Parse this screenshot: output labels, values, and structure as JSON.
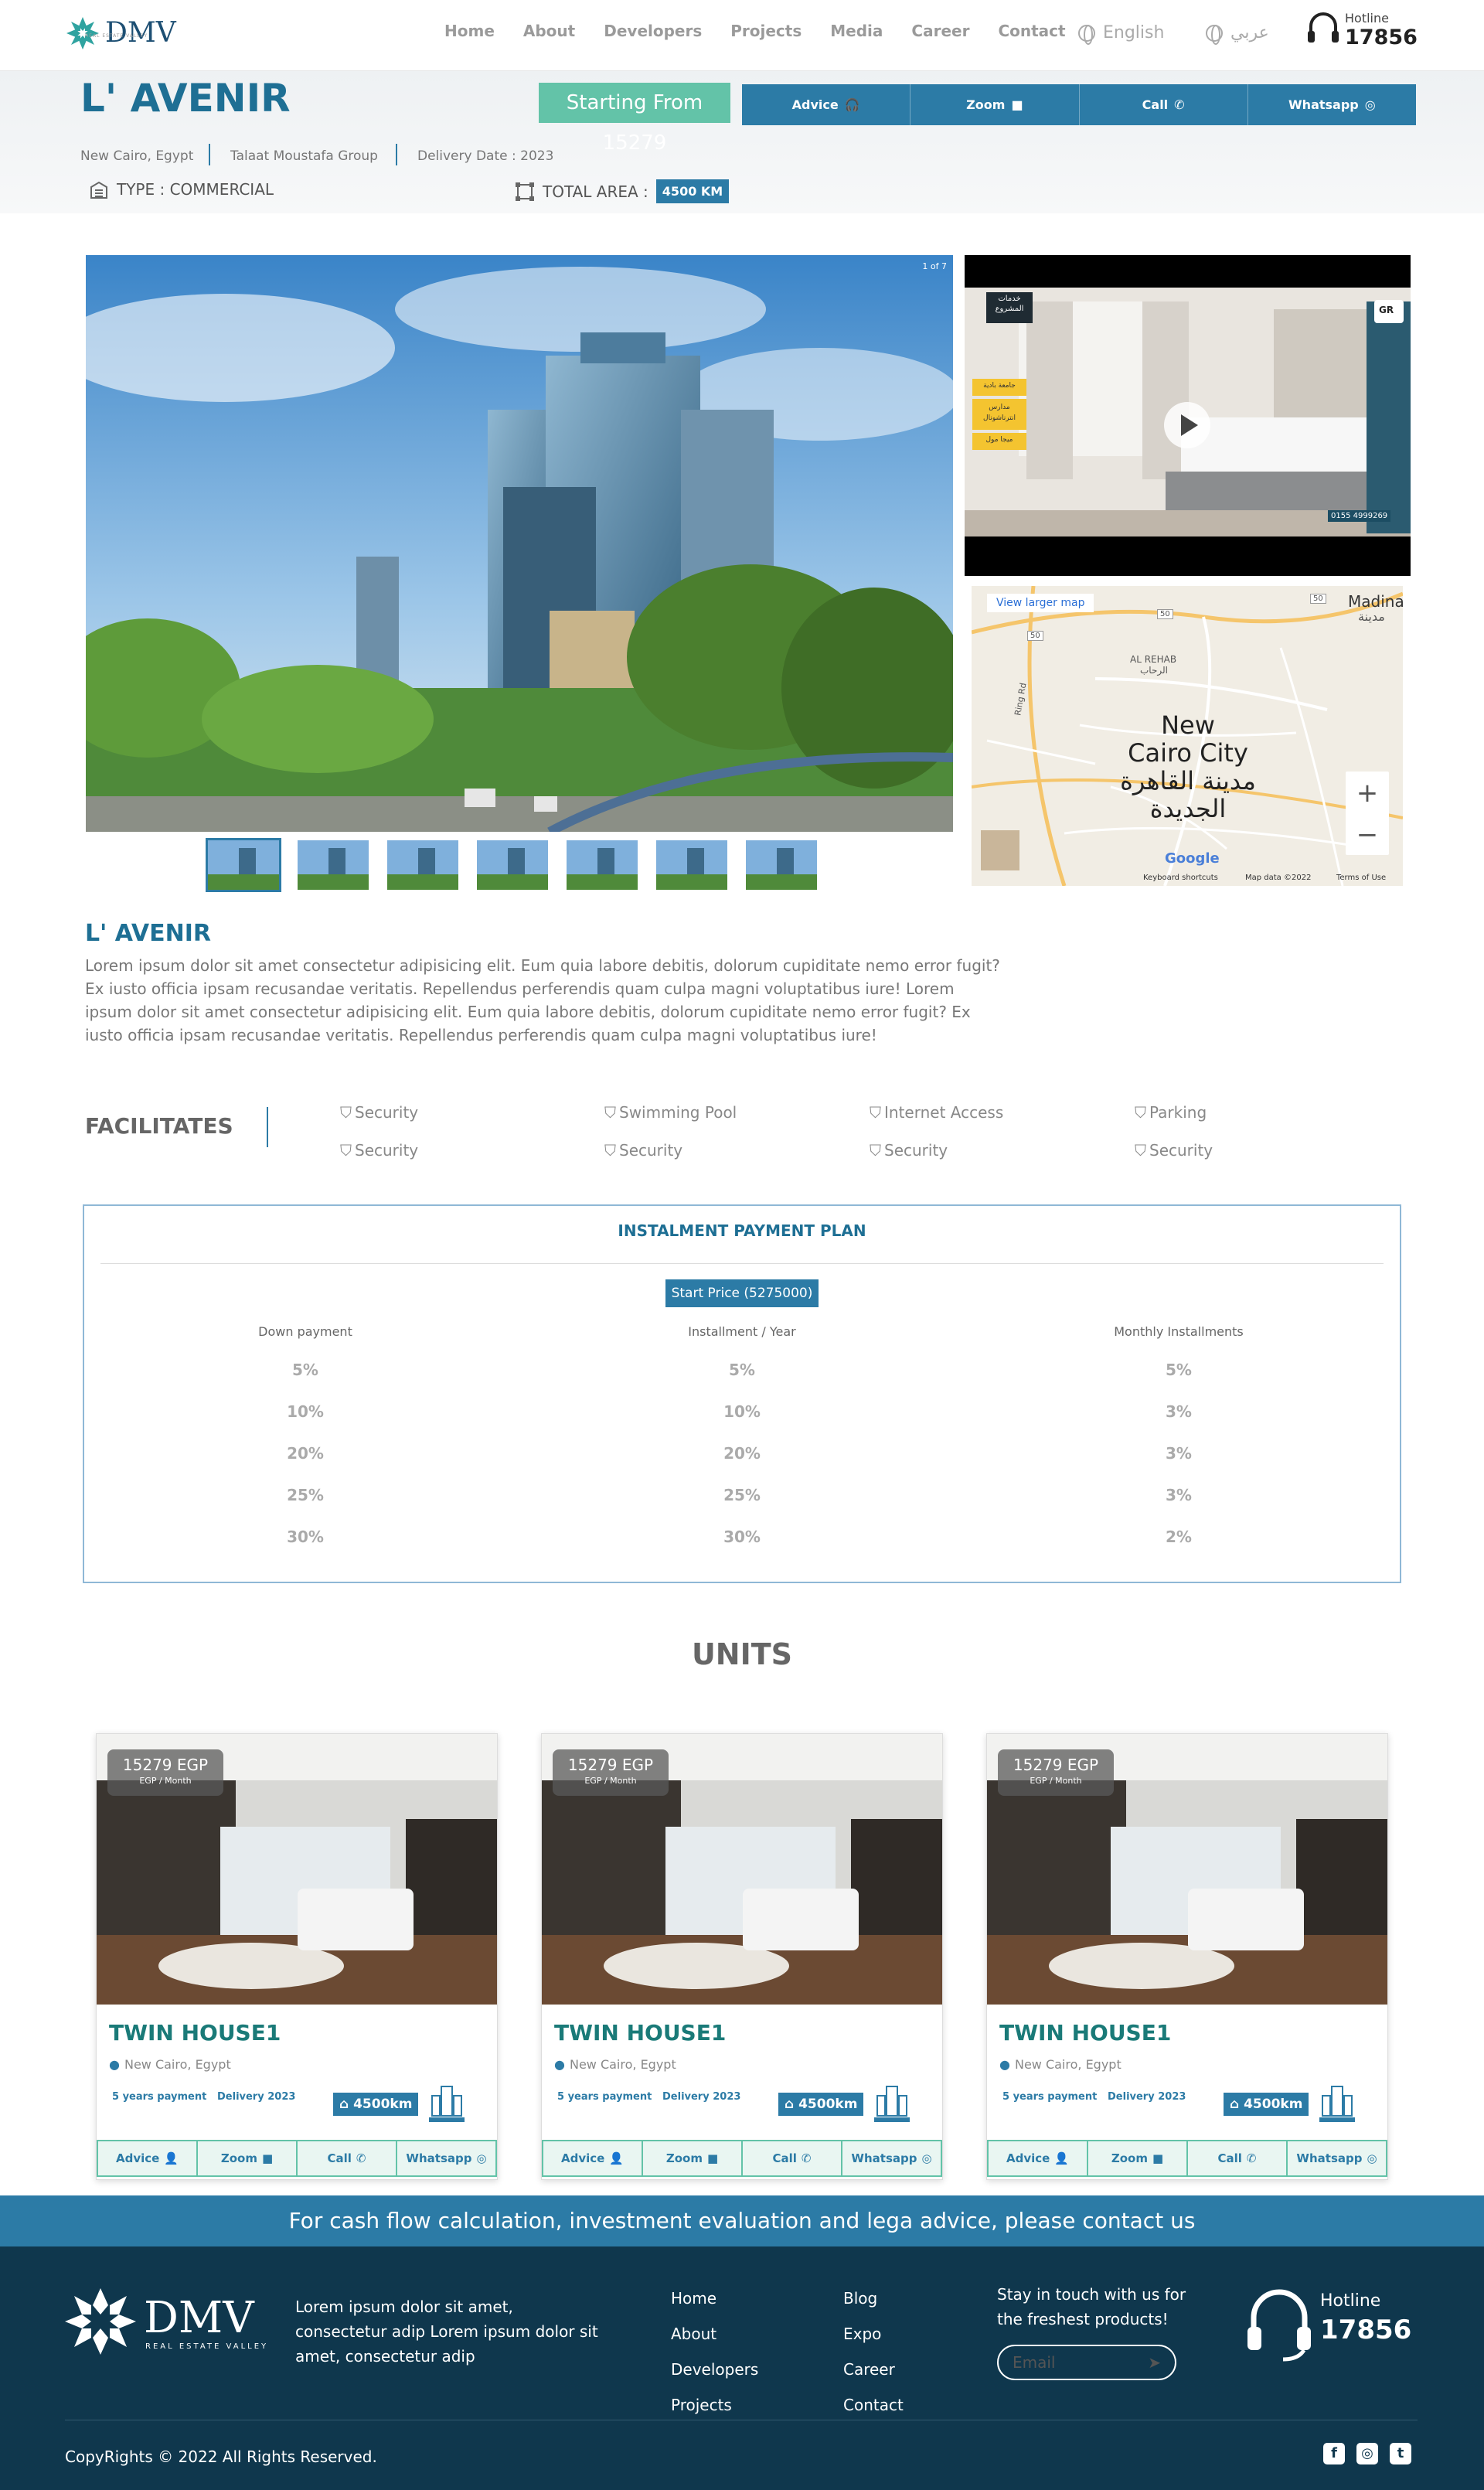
{
  "header": {
    "brand": "DMV",
    "brand_sub": "REAL ESTATE VALLEY",
    "nav": [
      "Home",
      "About",
      "Developers",
      "Projects",
      "Media",
      "Career",
      "Contact"
    ],
    "lang_en": "English",
    "lang_ar": "عربي",
    "hotline_label": "Hotline",
    "hotline_number": "17856"
  },
  "project": {
    "title": "L' AVENIR",
    "starting_from": "Starting From 15279",
    "actions": [
      "Advice",
      "Zoom",
      "Call",
      "Whatsapp"
    ],
    "location": "New Cairo, Egypt",
    "developer": "Talaat Moustafa Group",
    "delivery": "Delivery Date : 2023",
    "type": "TYPE : COMMERCIAL",
    "area_label": "TOTAL AREA :",
    "area_value": "4500 KM"
  },
  "gallery": {
    "counter": "1 of 7",
    "thumb_count": 7
  },
  "video": {
    "badge": "GR",
    "overlay_ar_1": "خدمات المشروع",
    "overlay_ar_2": "جامعة بادية",
    "overlay_ar_3": "مدارس انترناشونال",
    "overlay_ar_4": "ميجا مول",
    "phone": "0155 4999269"
  },
  "map": {
    "larger": "View larger map",
    "city_en_1": "New",
    "city_en_2": "Cairo City",
    "city_ar_1": "مدينة القاهرة",
    "city_ar_2": "الجديدة",
    "madina": "Madina",
    "madina_ar": "مدينة",
    "rehab": "AL REHAB",
    "rehab_ar": "الرحاب",
    "road": "Ring Rd",
    "r50a": "50",
    "r50b": "50",
    "r50c": "50",
    "zoom_in": "+",
    "zoom_out": "−",
    "google": "Google",
    "shortcuts": "Keyboard shortcuts",
    "mapdata": "Map data ©2022",
    "terms": "Terms of Use"
  },
  "about": {
    "title": "L' AVENIR",
    "text": "Lorem ipsum dolor sit amet consectetur adipisicing elit. Eum quia labore debitis, dolorum cupiditate nemo error fugit? Ex iusto officia ipsam recusandae veritatis. Repellendus perferendis quam culpa magni voluptatibus iure! Lorem ipsum dolor sit amet consectetur adipisicing elit. Eum quia labore debitis, dolorum cupiditate nemo error fugit? Ex iusto officia ipsam recusandae veritatis. Repellendus perferendis quam culpa magni voluptatibus iure!"
  },
  "facilities": {
    "title": "FACILITATES",
    "items": [
      "Security",
      "Swimming Pool",
      "Internet Access",
      "Parking",
      "Security",
      "Security",
      "Security",
      "Security"
    ]
  },
  "plan": {
    "title": "INSTALMENT PAYMENT PLAN",
    "start_price": "Start Price (5275000)",
    "columns": [
      "Down payment",
      "Installment / Year",
      "Monthly Installments"
    ],
    "rows": [
      [
        "5%",
        "5%",
        "5%"
      ],
      [
        "10%",
        "10%",
        "3%"
      ],
      [
        "20%",
        "20%",
        "3%"
      ],
      [
        "25%",
        "25%",
        "3%"
      ],
      [
        "30%",
        "30%",
        "2%"
      ]
    ]
  },
  "units": {
    "title": "UNITS",
    "cards": [
      {
        "price": "15279 EGP",
        "per": "EGP / Month",
        "name": "TWIN HOUSE1",
        "location": "New Cairo, Egypt",
        "payment": "5 years payment",
        "delivery": "Delivery 2023",
        "area": "4500km"
      },
      {
        "price": "15279 EGP",
        "per": "EGP / Month",
        "name": "TWIN HOUSE1",
        "location": "New Cairo, Egypt",
        "payment": "5 years payment",
        "delivery": "Delivery 2023",
        "area": "4500km"
      },
      {
        "price": "15279 EGP",
        "per": "EGP / Month",
        "name": "TWIN HOUSE1",
        "location": "New Cairo, Egypt",
        "payment": "5 years payment",
        "delivery": "Delivery 2023",
        "area": "4500km"
      }
    ],
    "actions": [
      "Advice",
      "Zoom",
      "Call",
      "Whatsapp"
    ]
  },
  "cta": "For cash flow calculation, investment evaluation and lega advice, please contact us",
  "footer": {
    "brand": "DMV",
    "brand_sub": "REAL ESTATE VALLEY",
    "about": "Lorem ipsum dolor sit amet, consectetur adip Lorem ipsum dolor sit amet, consectetur adip",
    "links_1": [
      "Home",
      "About",
      "Developers",
      "Projects"
    ],
    "links_2": [
      "Blog",
      "Expo",
      "Career",
      "Contact"
    ],
    "newsletter": "Stay in touch with us for the freshest products!",
    "email_placeholder": "Email",
    "hotline_label": "Hotline",
    "hotline_number": "17856",
    "copyright": "CopyRights © 2022 All Rights Reserved."
  },
  "colors": {
    "primary": "#2c7ba6",
    "accent": "#63c3a8",
    "footer": "#0f374d",
    "title": "#1e6f94"
  }
}
